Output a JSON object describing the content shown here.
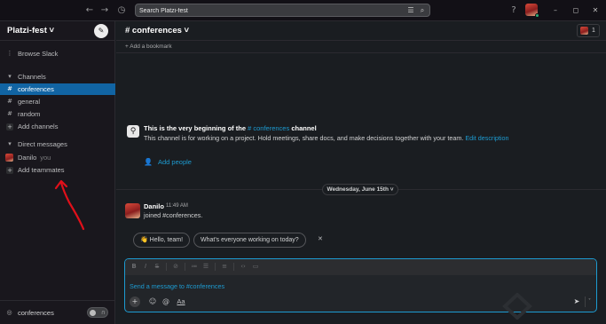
{
  "topbar": {
    "back_icon": "arrow-left-icon",
    "forward_icon": "arrow-right-icon",
    "history_icon": "clock-icon",
    "search_placeholder": "Search Platzi-fest",
    "help_icon": "question-icon",
    "minimize": "–",
    "maximize": "◻",
    "close": "✕"
  },
  "sidebar": {
    "workspace_name": "Platzi-fest ˅",
    "browse_label": "Browse Slack",
    "channels_header": "Channels",
    "channels": [
      {
        "label": "conferences",
        "active": true
      },
      {
        "label": "general",
        "active": false
      },
      {
        "label": "random",
        "active": false
      }
    ],
    "add_channels": "Add channels",
    "dm_header": "Direct messages",
    "dms": [
      {
        "label": "Danilo",
        "tag": "you"
      }
    ],
    "add_teammates": "Add teammates",
    "huddle_label": "conferences"
  },
  "channel": {
    "title": "# conferences ˅",
    "member_count": "1",
    "add_bookmark": "+ Add a bookmark",
    "intro_line1_prefix": "This is the very beginning of the ",
    "intro_line1_link": "# conferences",
    "intro_line1_suffix": " channel",
    "intro_line2_text": "This channel is for working on a project. Hold meetings, share docs, and make decisions together with your team. ",
    "intro_line2_link": "Edit description",
    "add_people": "Add people",
    "date_label": "Wednesday, June 15th ˅"
  },
  "messages": [
    {
      "author": "Danilo",
      "time": "11:49 AM",
      "text": "joined #conferences."
    }
  ],
  "suggestions": [
    "👋 Hello, team!",
    "What's everyone working on today?"
  ],
  "composer": {
    "placeholder": "Send a message to #conferences",
    "format_aa": "Aa"
  },
  "colors": {
    "accent": "#1164a3",
    "link": "#1d9bd1",
    "annotation": "#e0101a"
  }
}
